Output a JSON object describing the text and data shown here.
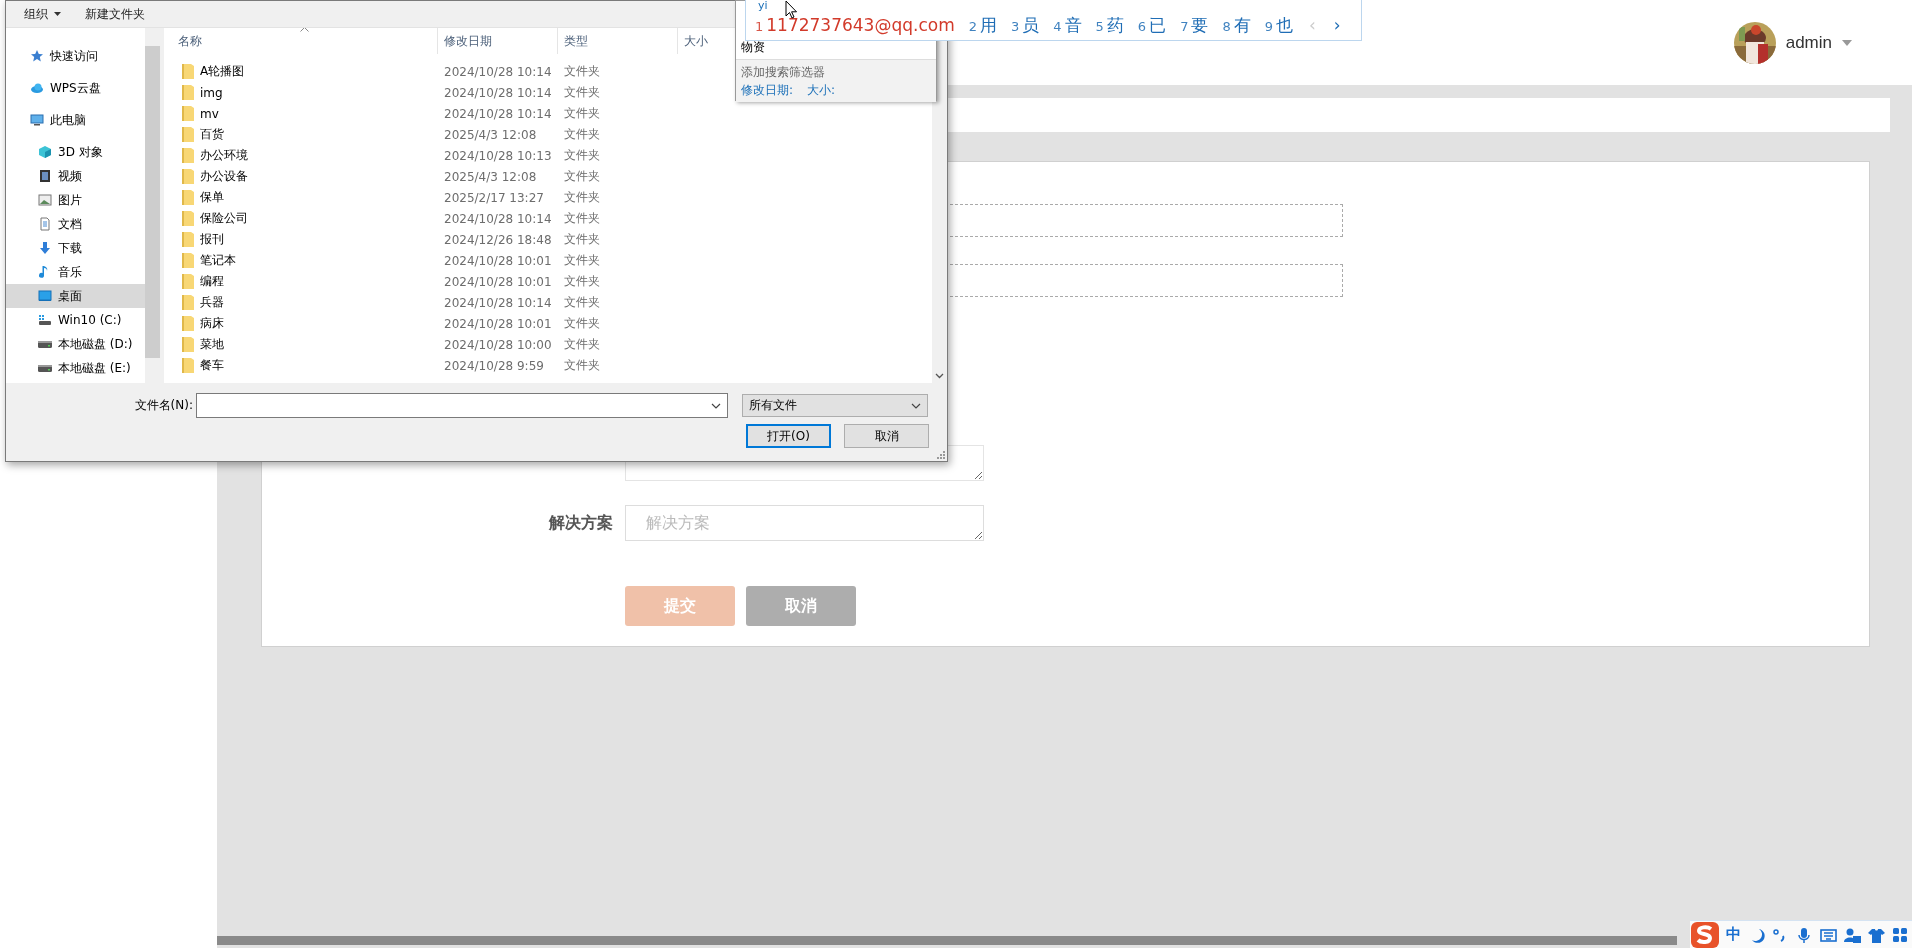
{
  "header": {
    "user": "admin"
  },
  "form": {
    "dashed_fields": [
      {
        "kind": "dashed"
      },
      {
        "kind": "dashed"
      }
    ],
    "text_fields": [
      {
        "kind": "covered"
      },
      {
        "label": "解决方案",
        "placeholder": "解决方案"
      }
    ],
    "buttons": [
      {
        "label": "提交",
        "kind": "submit"
      },
      {
        "label": "取消",
        "kind": "cancel"
      }
    ]
  },
  "file_dialog": {
    "toolbar": {
      "organize": "组织",
      "new_folder": "新建文件夹"
    },
    "nav": [
      {
        "label": "快速访问",
        "selected": false
      },
      {
        "label": "WPS云盘",
        "selected": false
      },
      {
        "label": "此电脑",
        "selected": false,
        "children": [
          {
            "label": "3D 对象",
            "selected": false
          },
          {
            "label": "视频",
            "selected": false
          },
          {
            "label": "图片",
            "selected": false
          },
          {
            "label": "文档",
            "selected": false
          },
          {
            "label": "下载",
            "selected": false
          },
          {
            "label": "音乐",
            "selected": false
          },
          {
            "label": "桌面",
            "selected": true
          },
          {
            "label": "Win10 (C:)",
            "selected": false
          },
          {
            "label": "本地磁盘 (D:)",
            "selected": false
          },
          {
            "label": "本地磁盘 (E:)",
            "selected": false
          }
        ]
      }
    ],
    "columns": [
      "名称",
      "修改日期",
      "类型",
      "大小"
    ],
    "files": [
      {
        "name": "A轮播图",
        "modified": "2024/10/28 10:14",
        "type": "文件夹"
      },
      {
        "name": "img",
        "modified": "2024/10/28 10:14",
        "type": "文件夹"
      },
      {
        "name": "mv",
        "modified": "2024/10/28 10:14",
        "type": "文件夹"
      },
      {
        "name": "百货",
        "modified": "2025/4/3 12:08",
        "type": "文件夹"
      },
      {
        "name": "办公环境",
        "modified": "2024/10/28 10:13",
        "type": "文件夹"
      },
      {
        "name": "办公设备",
        "modified": "2025/4/3 12:08",
        "type": "文件夹"
      },
      {
        "name": "保单",
        "modified": "2025/2/17 13:27",
        "type": "文件夹"
      },
      {
        "name": "保险公司",
        "modified": "2024/10/28 10:14",
        "type": "文件夹"
      },
      {
        "name": "报刊",
        "modified": "2024/12/26 18:48",
        "type": "文件夹"
      },
      {
        "name": "笔记本",
        "modified": "2024/10/28 10:01",
        "type": "文件夹"
      },
      {
        "name": "编程",
        "modified": "2024/10/28 10:01",
        "type": "文件夹"
      },
      {
        "name": "兵器",
        "modified": "2024/10/28 10:14",
        "type": "文件夹"
      },
      {
        "name": "病床",
        "modified": "2024/10/28 10:01",
        "type": "文件夹"
      },
      {
        "name": "菜地",
        "modified": "2024/10/28 10:00",
        "type": "文件夹"
      },
      {
        "name": "餐车",
        "modified": "2024/10/28 9:59",
        "type": "文件夹"
      }
    ],
    "filename_label": "文件名(N):",
    "filter": "所有文件",
    "buttons": [
      {
        "label": "打开(O)",
        "default": true
      },
      {
        "label": "取消",
        "default": false
      }
    ]
  },
  "search_suggestions": {
    "query": "物资",
    "hint": "添加搜索筛选器",
    "filters": [
      "修改日期:",
      "大小:"
    ]
  },
  "ime": {
    "pinyin": "yi",
    "candidates": [
      {
        "index": "1",
        "text": "1172737643@qq.com",
        "selected": true
      },
      {
        "index": "2",
        "text": "用",
        "selected": false
      },
      {
        "index": "3",
        "text": "员",
        "selected": false
      },
      {
        "index": "4",
        "text": "音",
        "selected": false
      },
      {
        "index": "5",
        "text": "药",
        "selected": false
      },
      {
        "index": "6",
        "text": "已",
        "selected": false
      },
      {
        "index": "7",
        "text": "要",
        "selected": false
      },
      {
        "index": "8",
        "text": "有",
        "selected": false
      },
      {
        "index": "9",
        "text": "也",
        "selected": false
      }
    ],
    "prev": {
      "label": "‹",
      "disabled": true
    },
    "next": {
      "label": "›",
      "disabled": false
    }
  },
  "ime_status": {
    "mode": "中"
  }
}
